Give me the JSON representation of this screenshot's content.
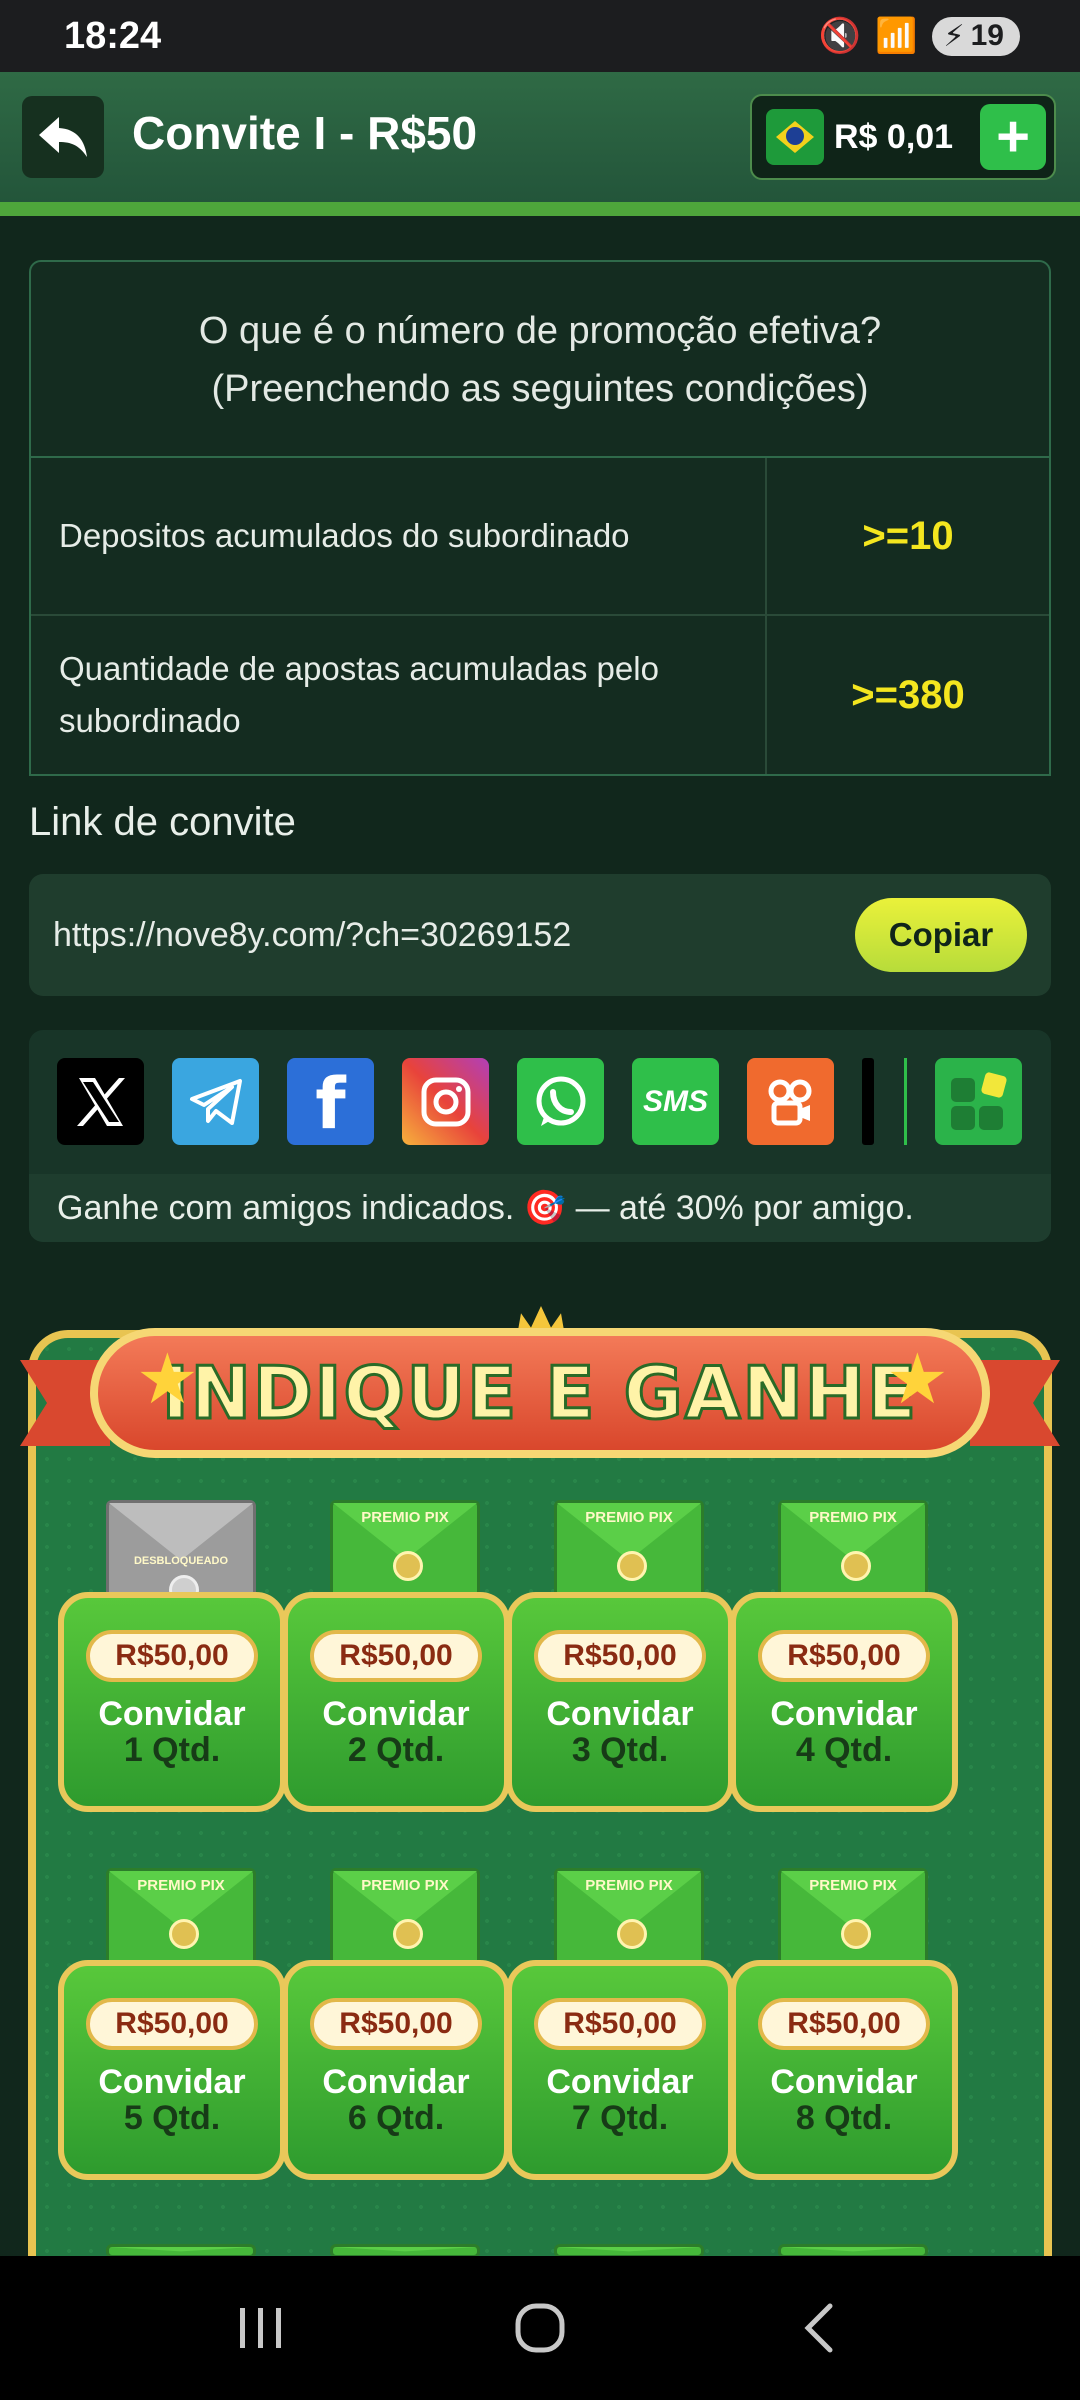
{
  "status_bar": {
    "time": "18:24",
    "battery": "19"
  },
  "header": {
    "title": "Convite I - R$50",
    "balance": "R$ 0,01"
  },
  "conditions": {
    "heading_line1": "O que é o número de promoção efetiva?",
    "heading_line2": "(Preenchendo as seguintes condições)",
    "rows": [
      {
        "label": "Depositos acumulados do subordinado",
        "value": ">=10"
      },
      {
        "label": "Quantidade de apostas acumuladas pelo subordinado",
        "value": ">=380"
      }
    ]
  },
  "invite": {
    "label": "Link de convite",
    "url": "https://nove8y.com/?ch=30269152",
    "copy_label": "Copiar"
  },
  "share": {
    "icons": [
      "x-icon",
      "telegram-icon",
      "facebook-icon",
      "instagram-icon",
      "whatsapp-icon",
      "sms-icon",
      "kwai-icon",
      "more-apps-icon"
    ],
    "sms_label": "SMS",
    "text": "Ganhe com amigos indicados. 🎯 — até 30% por amigo."
  },
  "promo": {
    "banner": "INDIQUE E GANHE",
    "envelope_label": "PREMIO PIX",
    "locked_label": "DESBLOQUEADO",
    "cards": [
      {
        "price": "R$50,00",
        "label": "Convidar",
        "qty": "1 Qtd.",
        "locked": true
      },
      {
        "price": "R$50,00",
        "label": "Convidar",
        "qty": "2 Qtd.",
        "locked": false
      },
      {
        "price": "R$50,00",
        "label": "Convidar",
        "qty": "3 Qtd.",
        "locked": false
      },
      {
        "price": "R$50,00",
        "label": "Convidar",
        "qty": "4 Qtd.",
        "locked": false
      },
      {
        "price": "R$50,00",
        "label": "Convidar",
        "qty": "5 Qtd.",
        "locked": false
      },
      {
        "price": "R$50,00",
        "label": "Convidar",
        "qty": "6 Qtd.",
        "locked": false
      },
      {
        "price": "R$50,00",
        "label": "Convidar",
        "qty": "7 Qtd.",
        "locked": false
      },
      {
        "price": "R$50,00",
        "label": "Convidar",
        "qty": "8 Qtd.",
        "locked": false
      }
    ]
  }
}
